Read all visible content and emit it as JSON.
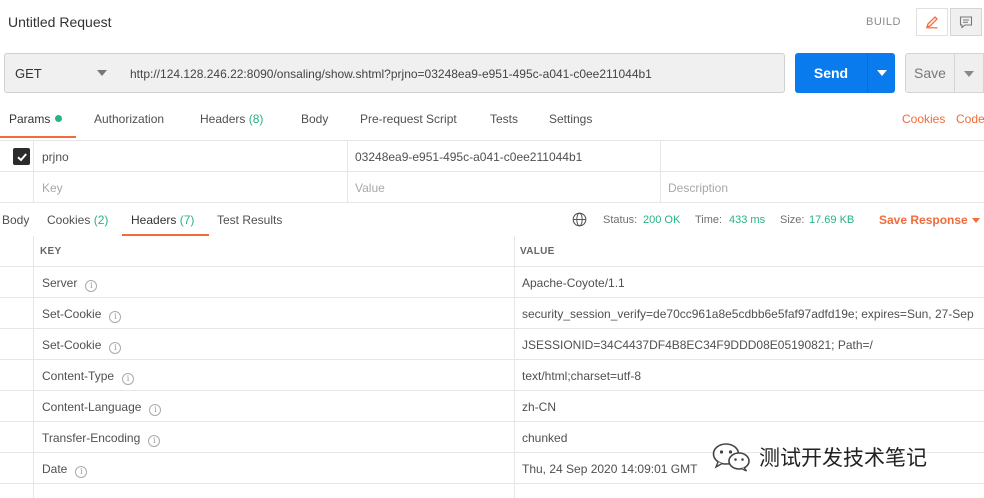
{
  "request": {
    "title": "Untitled Request",
    "build_label": "BUILD",
    "method": "GET",
    "url": "http://124.128.246.22:8090/onsaling/show.shtml?prjno=03248ea9-e951-495c-a041-c0ee211044b1",
    "send_label": "Send",
    "save_label": "Save"
  },
  "request_tabs": {
    "params": "Params",
    "authorization": "Authorization",
    "headers": "Headers",
    "headers_count": "(8)",
    "body": "Body",
    "prerequest": "Pre-request Script",
    "tests": "Tests",
    "settings": "Settings",
    "cookies_link": "Cookies",
    "code_link": "Code"
  },
  "params": {
    "rows": [
      {
        "checked": true,
        "key": "prjno",
        "value": "03248ea9-e951-495c-a041-c0ee211044b1",
        "description": ""
      }
    ],
    "placeholder": {
      "key": "Key",
      "value": "Value",
      "description": "Description"
    }
  },
  "response_tabs": {
    "body": "Body",
    "cookies": "Cookies",
    "cookies_count": "(2)",
    "headers": "Headers",
    "headers_count": "(7)",
    "test_results": "Test Results"
  },
  "response_status": {
    "status_label": "Status:",
    "status_value": "200 OK",
    "time_label": "Time:",
    "time_value": "433 ms",
    "size_label": "Size:",
    "size_value": "17.69 KB",
    "save_response": "Save Response"
  },
  "response_headers": {
    "key_col": "KEY",
    "value_col": "VALUE",
    "rows": [
      {
        "key": "Server",
        "value": "Apache-Coyote/1.1"
      },
      {
        "key": "Set-Cookie",
        "value": "security_session_verify=de70cc961a8e5cdbb6e5faf97adfd19e; expires=Sun, 27-Sep"
      },
      {
        "key": "Set-Cookie",
        "value": "JSESSIONID=34C4437DF4B8EC34F9DDD08E05190821; Path=/"
      },
      {
        "key": "Content-Type",
        "value": "text/html;charset=utf-8"
      },
      {
        "key": "Content-Language",
        "value": "zh-CN"
      },
      {
        "key": "Transfer-Encoding",
        "value": "chunked"
      },
      {
        "key": "Date",
        "value": "Thu, 24 Sep 2020 14:09:01 GMT"
      }
    ]
  },
  "watermark": {
    "text": "测试开发技术笔记",
    "icon": "wechat-icon"
  },
  "colors": {
    "accent": "#f26b3a",
    "send_blue": "#097bed",
    "success_green": "#26b47f"
  }
}
